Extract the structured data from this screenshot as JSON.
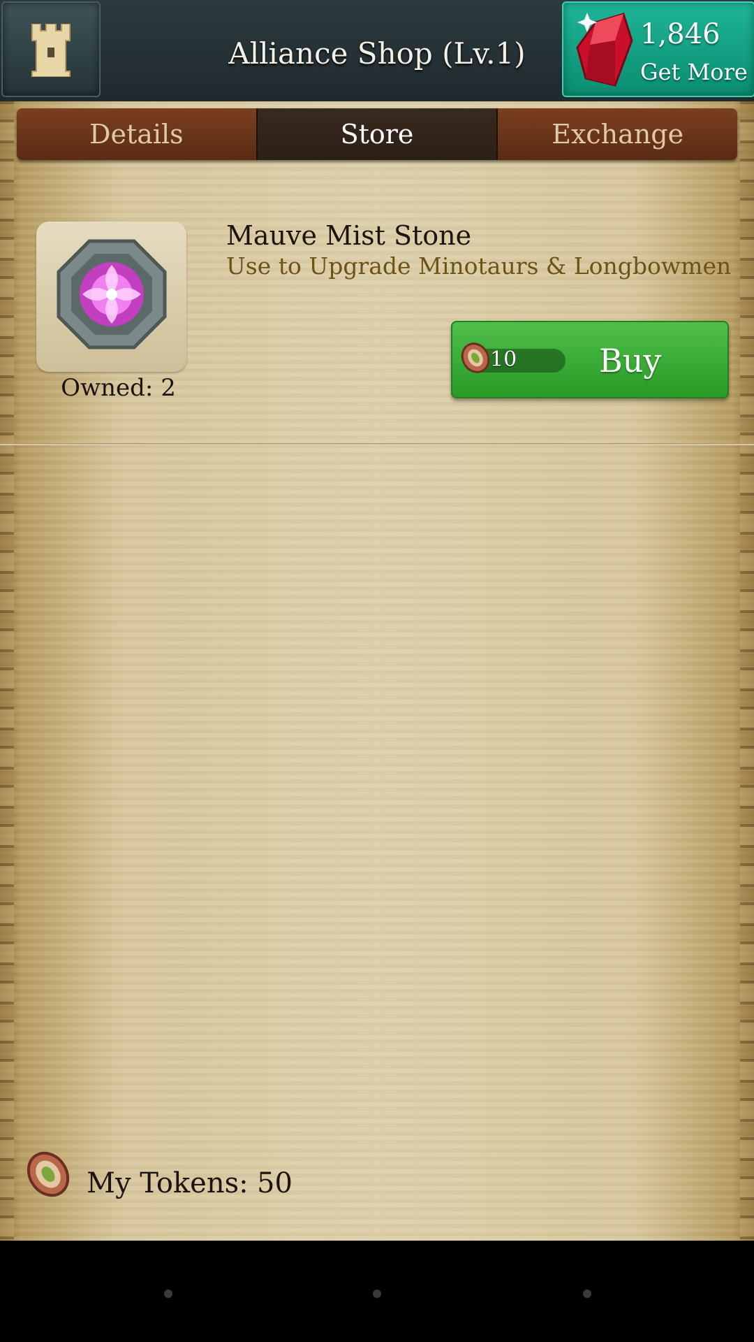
{
  "header": {
    "title": "Alliance Shop (Lv.1)",
    "castle_icon": "castle-tower-icon",
    "gems": {
      "count": "1,846",
      "action": "Get More",
      "icon": "red-gem-icon"
    }
  },
  "tabs": [
    {
      "label": "Details",
      "active": false
    },
    {
      "label": "Store",
      "active": true
    },
    {
      "label": "Exchange",
      "active": false
    }
  ],
  "items": [
    {
      "name": "Mauve Mist Stone",
      "description": "Use to Upgrade Minotaurs & Longbowmen",
      "owned": "Owned: 2",
      "icon": "mauve-mist-stone-icon",
      "price": "10",
      "price_icon": "alliance-token-icon",
      "buy_label": "Buy"
    }
  ],
  "footer": {
    "tokens_label": "My Tokens:",
    "tokens_value": "50",
    "tokens_icon": "alliance-token-icon"
  },
  "colors": {
    "header": "#25323a",
    "gem_button": "#14a686",
    "tab_bar": "#6b3519",
    "buy_button": "#3aab35",
    "description_text": "#6b5316"
  }
}
